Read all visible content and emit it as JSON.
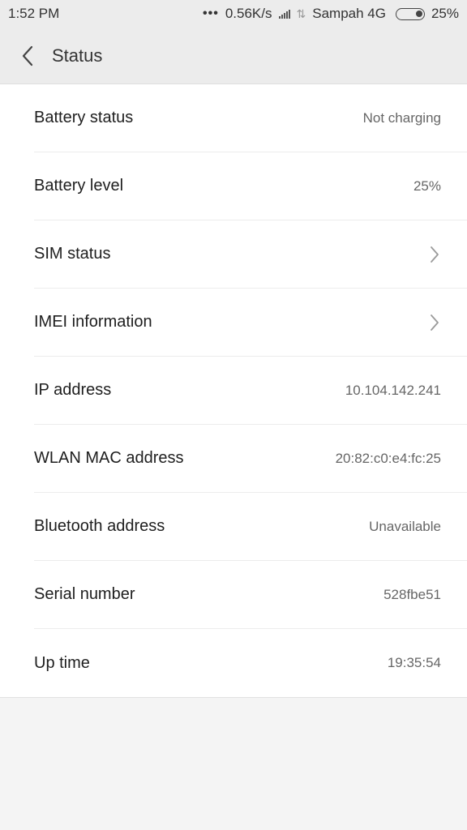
{
  "status_bar": {
    "time": "1:52 PM",
    "dots": "•••",
    "speed": "0.56K/s",
    "carrier": "Sampah 4G",
    "battery_text": "25%"
  },
  "header": {
    "title": "Status"
  },
  "items": [
    {
      "label": "Battery status",
      "value": "Not charging"
    },
    {
      "label": "Battery level",
      "value": "25%"
    },
    {
      "label": "SIM status"
    },
    {
      "label": "IMEI information"
    },
    {
      "label": "IP address",
      "value": "10.104.142.241"
    },
    {
      "label": "WLAN MAC address",
      "value": "20:82:c0:e4:fc:25"
    },
    {
      "label": "Bluetooth address",
      "value": "Unavailable"
    },
    {
      "label": "Serial number",
      "value": "528fbe51"
    },
    {
      "label": "Up time",
      "value": "19:35:54"
    }
  ],
  "colors": {
    "background": "#f4f4f4",
    "header": "#ececec",
    "card": "#ffffff"
  },
  "icons": {
    "back": "chevron-left-icon",
    "row_arrow": "chevron-right-icon"
  }
}
